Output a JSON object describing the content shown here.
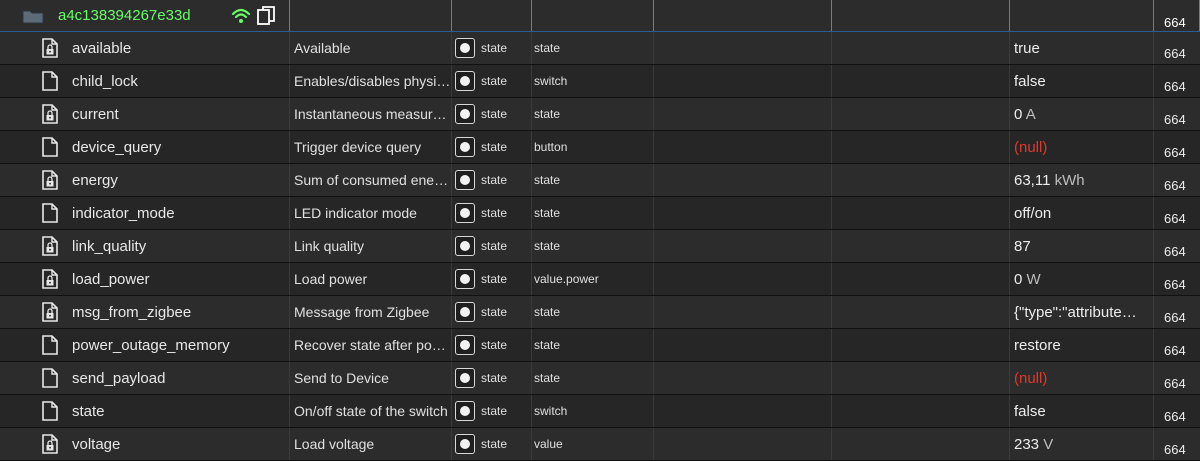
{
  "header": {
    "device_id": "a4c138394267e33d",
    "ack": "664"
  },
  "rows": [
    {
      "name": "available",
      "desc": "Available",
      "type": "state",
      "role": "state",
      "value": "true",
      "unit": "",
      "null": false,
      "ack": "664",
      "locked": true
    },
    {
      "name": "child_lock",
      "desc": "Enables/disables physi…",
      "type": "state",
      "role": "switch",
      "value": "false",
      "unit": "",
      "null": false,
      "ack": "664",
      "locked": false
    },
    {
      "name": "current",
      "desc": "Instantaneous measur…",
      "type": "state",
      "role": "state",
      "value": "0",
      "unit": "A",
      "null": false,
      "ack": "664",
      "locked": true
    },
    {
      "name": "device_query",
      "desc": "Trigger device query",
      "type": "state",
      "role": "button",
      "value": "(null)",
      "unit": "",
      "null": true,
      "ack": "664",
      "locked": false
    },
    {
      "name": "energy",
      "desc": "Sum of consumed ene…",
      "type": "state",
      "role": "state",
      "value": "63,11",
      "unit": "kWh",
      "null": false,
      "ack": "664",
      "locked": true
    },
    {
      "name": "indicator_mode",
      "desc": "LED indicator mode",
      "type": "state",
      "role": "state",
      "value": "off/on",
      "unit": "",
      "null": false,
      "ack": "664",
      "locked": false
    },
    {
      "name": "link_quality",
      "desc": "Link quality",
      "type": "state",
      "role": "state",
      "value": "87",
      "unit": "",
      "null": false,
      "ack": "664",
      "locked": true
    },
    {
      "name": "load_power",
      "desc": "Load power",
      "type": "state",
      "role": "value.power",
      "value": "0",
      "unit": "W",
      "null": false,
      "ack": "664",
      "locked": true
    },
    {
      "name": "msg_from_zigbee",
      "desc": "Message from Zigbee",
      "type": "state",
      "role": "state",
      "value": "{\"type\":\"attribute…",
      "unit": "",
      "null": false,
      "ack": "664",
      "locked": true
    },
    {
      "name": "power_outage_memory",
      "desc": "Recover state after po…",
      "type": "state",
      "role": "state",
      "value": "restore",
      "unit": "",
      "null": false,
      "ack": "664",
      "locked": false
    },
    {
      "name": "send_payload",
      "desc": "Send to Device",
      "type": "state",
      "role": "state",
      "value": "(null)",
      "unit": "",
      "null": true,
      "ack": "664",
      "locked": false
    },
    {
      "name": "state",
      "desc": "On/off state of the switch",
      "type": "state",
      "role": "switch",
      "value": "false",
      "unit": "",
      "null": false,
      "ack": "664",
      "locked": false
    },
    {
      "name": "voltage",
      "desc": "Load voltage",
      "type": "state",
      "role": "value",
      "value": "233",
      "unit": "V",
      "null": false,
      "ack": "664",
      "locked": true
    }
  ],
  "icons": {
    "folder": "folder-icon",
    "wifi": "wifi-icon",
    "copy": "copy-icon",
    "file": "file-icon",
    "file_locked": "file-lock-icon",
    "state_type": "state-type-icon"
  },
  "colors": {
    "header_bg": "#3a74ad",
    "device_id": "#66ff66",
    "wifi": "#66ff66",
    "null_value": "#e0392b"
  }
}
